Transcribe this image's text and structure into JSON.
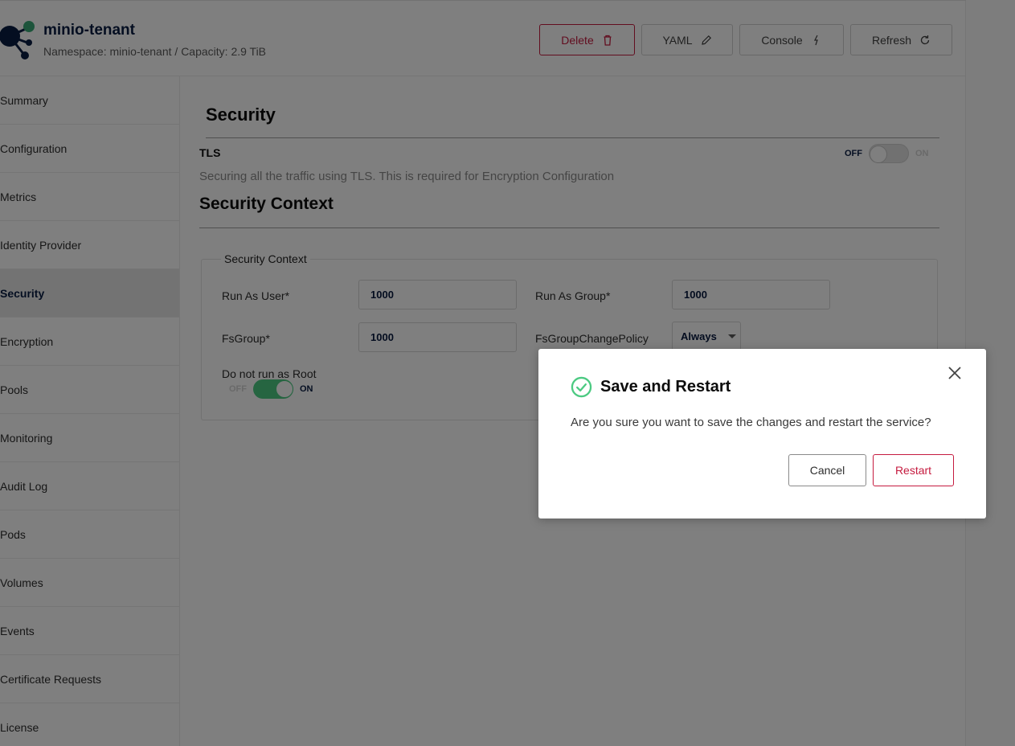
{
  "header": {
    "tenant_name": "minio-tenant",
    "subtitle": "Namespace: minio-tenant / Capacity: 2.9 TiB",
    "buttons": {
      "delete": "Delete",
      "yaml": "YAML",
      "console": "Console",
      "refresh": "Refresh"
    }
  },
  "sidebar": {
    "items": [
      {
        "label": "Summary"
      },
      {
        "label": "Configuration"
      },
      {
        "label": "Metrics"
      },
      {
        "label": "Identity Provider"
      },
      {
        "label": "Security",
        "active": true
      },
      {
        "label": "Encryption"
      },
      {
        "label": "Pools"
      },
      {
        "label": "Monitoring"
      },
      {
        "label": "Audit Log"
      },
      {
        "label": "Pods"
      },
      {
        "label": "Volumes"
      },
      {
        "label": "Events"
      },
      {
        "label": "Certificate Requests"
      },
      {
        "label": "License"
      }
    ]
  },
  "main": {
    "title": "Security",
    "tls": {
      "label": "TLS",
      "description": "Securing all the traffic using TLS. This is required for Encryption Configuration",
      "off_label": "OFF",
      "on_label": "ON",
      "enabled": false
    },
    "security_context": {
      "title": "Security Context",
      "legend": "Security Context",
      "run_as_user_label": "Run As User*",
      "run_as_user_value": "1000",
      "run_as_group_label": "Run As Group*",
      "run_as_group_value": "1000",
      "fs_group_label": "FsGroup*",
      "fs_group_value": "1000",
      "fs_group_change_policy_label": "FsGroupChangePolicy",
      "fs_group_change_policy_value": "Always",
      "run_as_non_root_label": "Do not run as Root",
      "run_as_non_root_off": "OFF",
      "run_as_non_root_on": "ON",
      "run_as_non_root_enabled": true
    }
  },
  "modal": {
    "title": "Save and Restart",
    "message": "Are you sure you want to save the changes and restart the service?",
    "cancel_label": "Cancel",
    "restart_label": "Restart"
  },
  "colors": {
    "accent_red": "#c51b3f",
    "toggle_green": "#4cca82",
    "check_green": "#4cca82",
    "overlay": "rgba(0,0,0,0.5)"
  }
}
